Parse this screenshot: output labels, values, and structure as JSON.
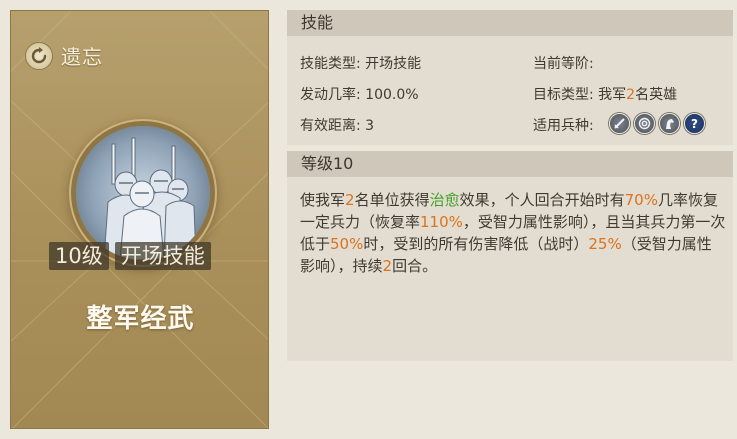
{
  "card": {
    "forget_label": "遗忘",
    "level_badge": "10级",
    "type_badge": "开场技能",
    "skill_name": "整军经武"
  },
  "skill_panel": {
    "title": "技能",
    "skill_type_label": "技能类型:",
    "skill_type_value": "开场技能",
    "current_rank_label": "当前等阶:",
    "current_rank_value": "",
    "trigger_rate_label": "发动几率:",
    "trigger_rate_value": "100.0%",
    "target_type_label": "目标类型:",
    "target_type_value_pre": "我军",
    "target_type_value_num": "2",
    "target_type_value_post": "名英雄",
    "range_label": "有效距离:",
    "range_value": "3",
    "troop_label": "适用兵种:",
    "troop_icons": [
      "sword-icon",
      "bow-target-icon",
      "horse-icon",
      "question-icon"
    ]
  },
  "level_panel": {
    "title": "等级10",
    "desc": {
      "p1": "使我军",
      "n1": "2",
      "p2": "名单位获得",
      "heal": "治愈",
      "p3": "效果，个人回合开始时有",
      "n2": "70%",
      "p4": "几率恢复一定兵力（恢复率",
      "n3": "110%",
      "p5": "，受智力属性影响），且当其兵力第一次低于",
      "n4": "50%",
      "p6": "时，受到的所有伤害降低（战时）",
      "n5": "25%",
      "p7": "（受智力属性影响），持续",
      "n6": "2",
      "p8": "回合。"
    }
  },
  "colors": {
    "highlight_orange": "#d9731d",
    "highlight_green": "#3fa12a",
    "card_gold": "#a98f5a"
  }
}
